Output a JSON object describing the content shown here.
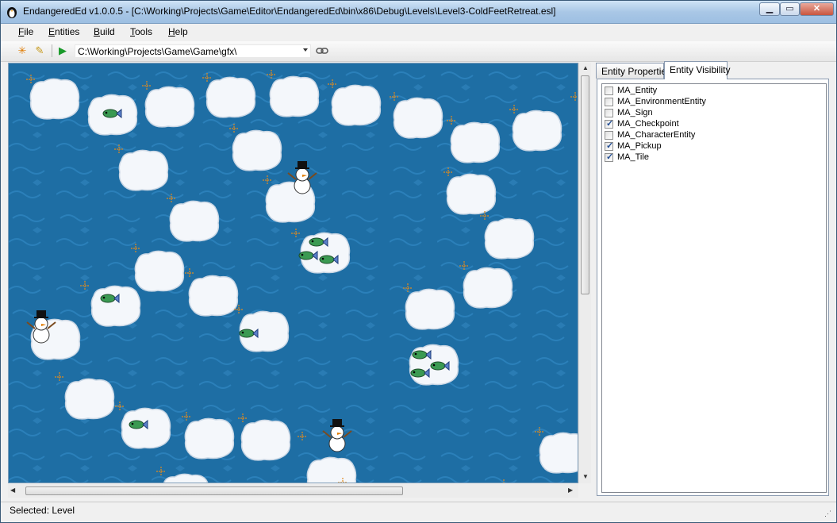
{
  "window": {
    "title": "EndangeredEd v1.0.0.5 - [C:\\Working\\Projects\\Game\\Editor\\EndangeredEd\\bin\\x86\\Debug\\Levels\\Level3-ColdFeetRetreat.esl]",
    "minimize_icon": "minimize-icon",
    "maximize_icon": "maximize-icon",
    "close_icon": "close-icon"
  },
  "menu": {
    "items": [
      "File",
      "Entities",
      "Build",
      "Tools",
      "Help"
    ]
  },
  "toolbar": {
    "path": "C:\\Working\\Projects\\Game\\Game\\gfx\\",
    "icons": [
      "sparkle-icon",
      "pencil-icon",
      "run-icon",
      "link-icon"
    ]
  },
  "colors": {
    "water": "#1e6ea4",
    "water_light": "#2a7fb8",
    "ice": "#f4f7fb",
    "marker": "#e08a1e"
  },
  "panel": {
    "tabs": [
      "Entity Properties",
      "Entity Visibility"
    ],
    "active_tab": "Entity Visibility",
    "visibility_items": [
      {
        "label": "MA_Entity",
        "checked": false
      },
      {
        "label": "MA_EnvironmentEntity",
        "checked": false
      },
      {
        "label": "MA_Sign",
        "checked": false
      },
      {
        "label": "MA_Checkpoint",
        "checked": true
      },
      {
        "label": "MA_CharacterEntity",
        "checked": false
      },
      {
        "label": "MA_Pickup",
        "checked": true
      },
      {
        "label": "MA_Tile",
        "checked": true
      }
    ]
  },
  "status": {
    "text": "Selected: Level"
  }
}
